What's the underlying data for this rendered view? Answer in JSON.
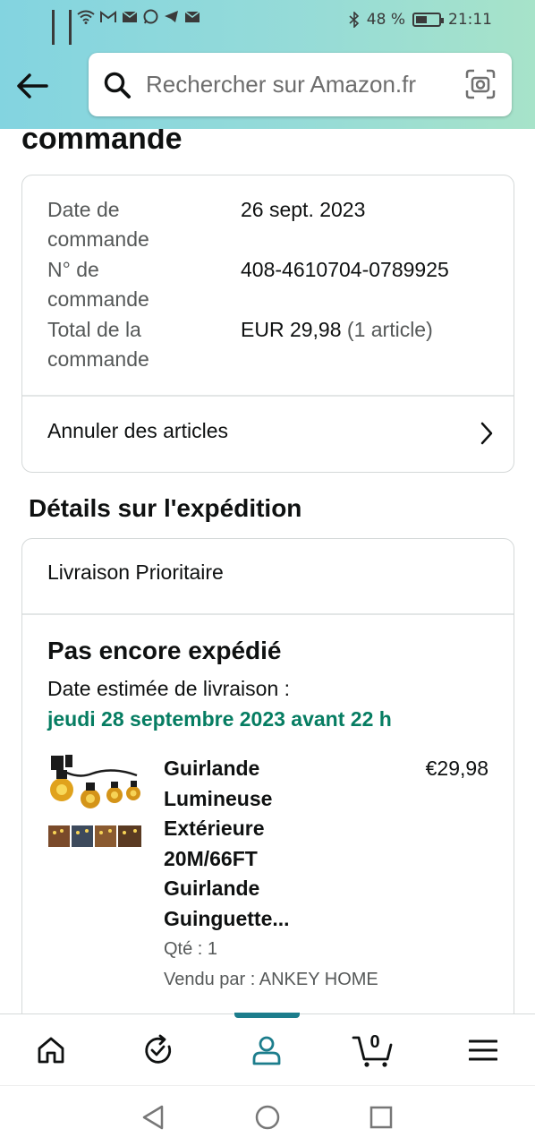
{
  "status_bar": {
    "battery": "48 %",
    "time": "21:11"
  },
  "search": {
    "placeholder": "Rechercher sur Amazon.fr"
  },
  "page": {
    "heading_partial": "commande"
  },
  "order_summary": {
    "rows": [
      {
        "label": "Date de commande",
        "value": "26 sept. 2023"
      },
      {
        "label": "N° de commande",
        "value": "408-4610704-0789925"
      },
      {
        "label": "Total de la commande",
        "value": "EUR 29,98",
        "value_extra": "(1 article)"
      }
    ],
    "cancel_label": "Annuler des articles"
  },
  "shipment": {
    "section_title": "Détails sur l'expédition",
    "method": "Livraison Prioritaire",
    "status": "Pas encore expédié",
    "eta_label": "Date estimée de livraison :",
    "eta_date": "jeudi 28 septembre 2023 avant 22 h",
    "eta_color": "#067d62",
    "item": {
      "title": "Guirlande Lumineuse Extérieure 20M/66FT Guirlande Guinguette...",
      "price": "€29,98",
      "qty": "Qté : 1",
      "seller": "Vendu par : ANKEY HOME"
    }
  },
  "bottom_nav": {
    "items": [
      "home-icon",
      "orders-icon",
      "account-icon",
      "cart-icon",
      "menu-icon"
    ],
    "active": "account-icon",
    "accent": "#1c7d8c",
    "cart_count": "0"
  }
}
